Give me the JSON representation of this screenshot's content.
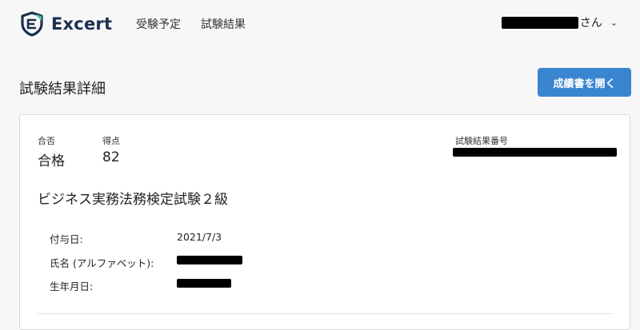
{
  "header": {
    "brand": "Excert",
    "nav": [
      "受験予定",
      "試験結果"
    ],
    "user_suffix": "さん",
    "user_chevron": "⌄"
  },
  "page": {
    "title": "試験結果詳細",
    "open_certificate_label": "成績書を開く"
  },
  "result": {
    "pass_label": "合否",
    "pass_value": "合格",
    "score_label": "得点",
    "score_value": "82",
    "result_number_label": "試験結果番号",
    "exam_name": "ビジネス実務法務検定試験２級",
    "details": [
      {
        "label": "付与日:",
        "value": "2021/7/3"
      },
      {
        "label": "氏名 (アルファベット):",
        "value": ""
      },
      {
        "label": "生年月日:",
        "value": ""
      }
    ]
  },
  "colors": {
    "brand_text": "#1c2f4f",
    "brand_shield": "#1c2f4f",
    "brand_accent": "#3cc8a8",
    "primary_button": "#3a85d0",
    "redaction": "#000000"
  },
  "icons": {
    "logo": "shield-logo-icon",
    "user_menu": "chevron-down-icon"
  }
}
